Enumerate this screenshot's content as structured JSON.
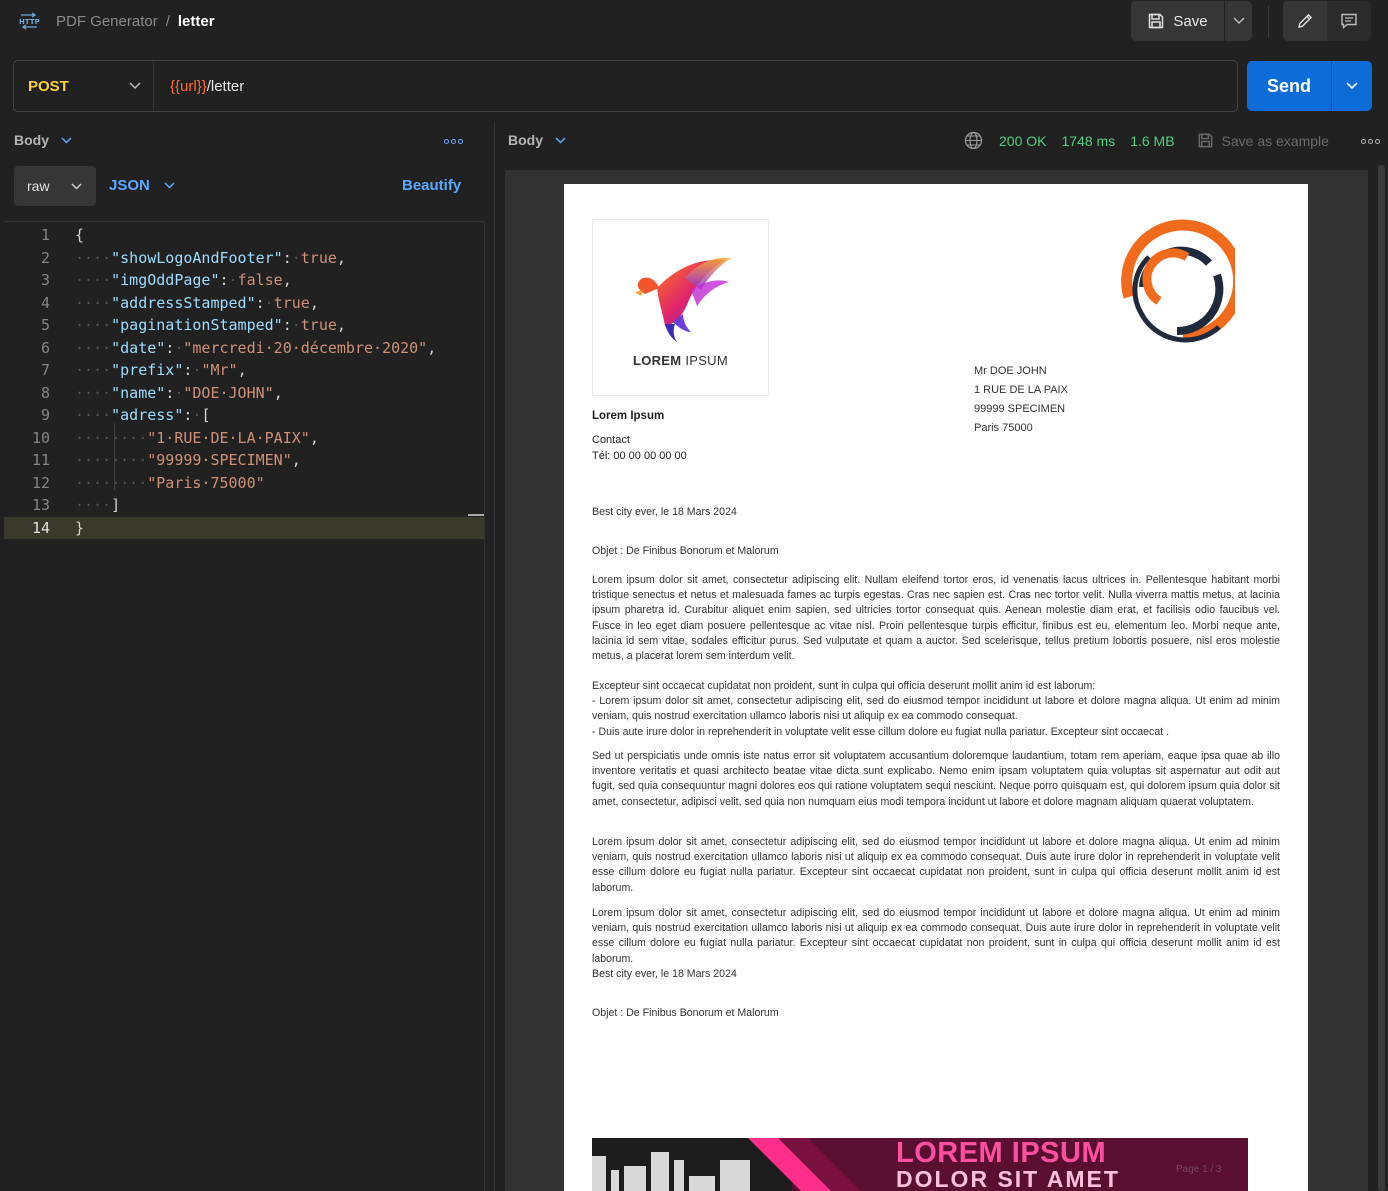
{
  "header": {
    "icon": "http-icon",
    "breadcrumb_parent": "PDF Generator",
    "breadcrumb_sep": "/",
    "breadcrumb_current": "letter",
    "save_label": "Save"
  },
  "request": {
    "method": "POST",
    "url_var": "{{url}}",
    "url_path": "/letter",
    "send_label": "Send"
  },
  "body_panel": {
    "title": "Body",
    "mode": "raw",
    "format": "JSON",
    "beautify_label": "Beautify",
    "lines": [
      {
        "n": "1",
        "segments": [
          {
            "t": "{",
            "c": "p"
          }
        ]
      },
      {
        "n": "2",
        "segments": [
          {
            "t": "····",
            "c": "dot"
          },
          {
            "t": "\"showLogoAndFooter\"",
            "c": "k"
          },
          {
            "t": ":",
            "c": "p"
          },
          {
            "t": "·",
            "c": "dot"
          },
          {
            "t": "true",
            "c": "s"
          },
          {
            "t": ",",
            "c": "p"
          }
        ]
      },
      {
        "n": "3",
        "segments": [
          {
            "t": "····",
            "c": "dot"
          },
          {
            "t": "\"imgOddPage\"",
            "c": "k"
          },
          {
            "t": ":",
            "c": "p"
          },
          {
            "t": "·",
            "c": "dot"
          },
          {
            "t": "false",
            "c": "s"
          },
          {
            "t": ",",
            "c": "p"
          }
        ]
      },
      {
        "n": "4",
        "segments": [
          {
            "t": "····",
            "c": "dot"
          },
          {
            "t": "\"addressStamped\"",
            "c": "k"
          },
          {
            "t": ":",
            "c": "p"
          },
          {
            "t": "·",
            "c": "dot"
          },
          {
            "t": "true",
            "c": "s"
          },
          {
            "t": ",",
            "c": "p"
          }
        ]
      },
      {
        "n": "5",
        "segments": [
          {
            "t": "····",
            "c": "dot"
          },
          {
            "t": "\"paginationStamped\"",
            "c": "k"
          },
          {
            "t": ":",
            "c": "p"
          },
          {
            "t": "·",
            "c": "dot"
          },
          {
            "t": "true",
            "c": "s"
          },
          {
            "t": ",",
            "c": "p"
          }
        ]
      },
      {
        "n": "6",
        "segments": [
          {
            "t": "····",
            "c": "dot"
          },
          {
            "t": "\"date\"",
            "c": "k"
          },
          {
            "t": ":",
            "c": "p"
          },
          {
            "t": "·",
            "c": "dot"
          },
          {
            "t": "\"mercredi·20·décembre·2020\"",
            "c": "s"
          },
          {
            "t": ",",
            "c": "p"
          }
        ]
      },
      {
        "n": "7",
        "segments": [
          {
            "t": "····",
            "c": "dot"
          },
          {
            "t": "\"prefix\"",
            "c": "k"
          },
          {
            "t": ":",
            "c": "p"
          },
          {
            "t": "·",
            "c": "dot"
          },
          {
            "t": "\"Mr\"",
            "c": "s"
          },
          {
            "t": ",",
            "c": "p"
          }
        ]
      },
      {
        "n": "8",
        "segments": [
          {
            "t": "····",
            "c": "dot"
          },
          {
            "t": "\"name\"",
            "c": "k"
          },
          {
            "t": ":",
            "c": "p"
          },
          {
            "t": "·",
            "c": "dot"
          },
          {
            "t": "\"DOE·JOHN\"",
            "c": "s"
          },
          {
            "t": ",",
            "c": "p"
          }
        ]
      },
      {
        "n": "9",
        "segments": [
          {
            "t": "····",
            "c": "dot"
          },
          {
            "t": "\"adress\"",
            "c": "k"
          },
          {
            "t": ":",
            "c": "p"
          },
          {
            "t": "·",
            "c": "dot"
          },
          {
            "t": "[",
            "c": "p"
          }
        ]
      },
      {
        "n": "10",
        "segments": [
          {
            "t": "········",
            "c": "dot"
          },
          {
            "t": "\"1·RUE·DE·LA·PAIX\"",
            "c": "s"
          },
          {
            "t": ",",
            "c": "p"
          }
        ]
      },
      {
        "n": "11",
        "segments": [
          {
            "t": "········",
            "c": "dot"
          },
          {
            "t": "\"99999·SPECIMEN\"",
            "c": "s"
          },
          {
            "t": ",",
            "c": "p"
          }
        ]
      },
      {
        "n": "12",
        "segments": [
          {
            "t": "········",
            "c": "dot"
          },
          {
            "t": "\"Paris·75000\"",
            "c": "s"
          }
        ]
      },
      {
        "n": "13",
        "segments": [
          {
            "t": "····",
            "c": "dot"
          },
          {
            "t": "]",
            "c": "p"
          }
        ]
      },
      {
        "n": "14",
        "segments": [
          {
            "t": "}",
            "c": "p"
          }
        ]
      }
    ]
  },
  "response": {
    "title": "Body",
    "status": "200 OK",
    "time": "1748 ms",
    "size": "1.6 MB",
    "save_example_label": "Save as example",
    "colors": {
      "ok": "#4cd07d",
      "accent": "#0c6cd8",
      "method": "#ffcf33"
    }
  },
  "pdf": {
    "logo_text_bold": "LOREM",
    "logo_text_light": " IPSUM",
    "recipient": [
      "Mr DOE JOHN",
      "1 RUE DE LA PAIX",
      "99999 SPECIMEN",
      "Paris 75000"
    ],
    "sender_name": "Lorem Ipsum",
    "sender_contact": "Contact",
    "sender_phone": "Tél: 00 00 00 00 00",
    "date_line": "Best city ever, le 18 Mars 2024",
    "object_line": "Objet : De Finibus Bonorum et Malorum",
    "p1": "Lorem ipsum dolor sit amet, consectetur adipiscing elit. Nullam eleifend tortor eros, id venenatis lacus ultrices in. Pellentesque habitant morbi tristique senectus et netus et malesuada fames ac turpis egestas. Cras nec sapien est. Cras nec tortor velit. Nulla viverra mattis metus, at lacinia ipsum pharetra id. Curabitur aliquet enim sapien, sed ultricies tortor consequat quis. Aenean molestie diam erat, et facilisis odio faucibus vel. Fusce in leo eget diam posuere pellentesque ac vitae nisl. Proin pellentesque turpis efficitur, finibus est eu, elementum leo. Morbi neque ante, lacinia id sem vitae, sodales efficitur purus. Sed vulputate et quam a auctor. Sed scelerisque, tellus pretium lobortis posuere, nisl eros molestie metus, a placerat lorem sem interdum velit.",
    "p2_intro": "Excepteur sint occaecat cupidatat non proident, sunt in culpa qui officia deserunt mollit anim id est laborum:",
    "p2_b1": "- Lorem ipsum dolor sit amet, consectetur adipiscing elit, sed do eiusmod tempor incididunt ut labore et dolore magna aliqua. Ut enim ad minim veniam, quis nostrud exercitation ullamco laboris nisi ut aliquip ex ea commodo consequat.",
    "p2_b2": "- Duis aute irure dolor in reprehenderit in voluptate velit esse cillum dolore eu fugiat nulla pariatur. Excepteur sint occaecat .",
    "p3": "Sed ut perspiciatis unde omnis iste natus error sit voluptatem accusantium doloremque laudantium, totam rem aperiam, eaque ipsa quae ab illo inventore veritatis et quasi architecto beatae vitae dicta sunt explicabo. Nemo enim ipsam voluptatem quia voluptas sit aspernatur aut odit aut fugit, sed quia consequuntur magni dolores eos qui ratione voluptatem sequi nesciunt. Neque porro quisquam est, qui dolorem ipsum quia dolor sit amet, consectetur, adipisci velit, sed quia non numquam eius modi tempora incidunt ut labore et dolore magnam aliquam quaerat voluptatem.",
    "p4": "Lorem ipsum dolor sit amet, consectetur adipiscing elit, sed do eiusmod tempor incididunt ut labore et dolore magna aliqua. Ut enim ad minim veniam, quis nostrud exercitation ullamco laboris nisi ut aliquip ex ea commodo consequat. Duis aute irure dolor in reprehenderit in voluptate velit esse cillum dolore eu fugiat nulla pariatur. Excepteur sint occaecat cupidatat non proident, sunt in culpa qui officia deserunt mollit anim id est laborum.",
    "p5": "Lorem ipsum dolor sit amet, consectetur adipiscing elit, sed do eiusmod tempor incididunt ut labore et dolore magna aliqua. Ut enim ad minim veniam, quis nostrud exercitation ullamco laboris nisi ut aliquip ex ea commodo consequat. Duis aute irure dolor in reprehenderit in voluptate velit esse cillum dolore eu fugiat nulla pariatur. Excepteur sint occaecat cupidatat non proident, sunt in culpa qui officia deserunt mollit anim id est laborum.",
    "date_line_2": "Best city ever, le 18 Mars 2024",
    "object_line_2": "Objet : De Finibus Bonorum et Malorum",
    "banner_title": "LOREM IPSUM",
    "banner_subtitle": "DOLOR SIT AMET",
    "page_label": "Page 1 / 3"
  }
}
